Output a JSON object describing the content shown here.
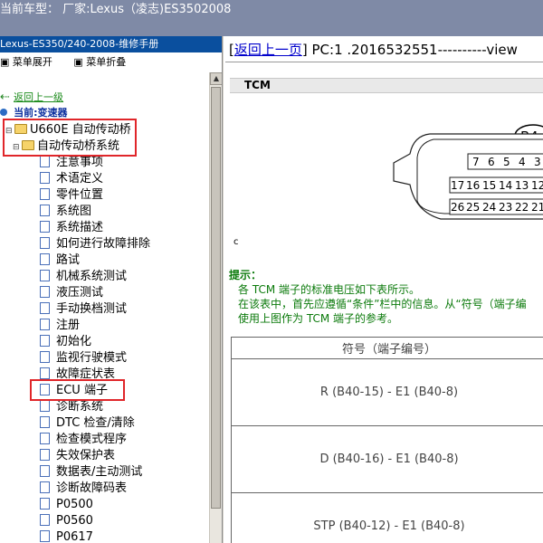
{
  "window": {
    "title": "当前车型：  厂家:Lexus（凌志)ES3502008"
  },
  "left_panel": {
    "header": "Lexus-ES350/240-2008-维修手册",
    "expand_all": "菜单展开",
    "collapse_all": "菜单折叠",
    "back_link": "返回上一级",
    "current_label": "当前:变速器",
    "folders": [
      {
        "label": "U660E 自动传动桥"
      },
      {
        "label": "自动传动桥系统"
      }
    ],
    "items": [
      "注意事项",
      "术语定义",
      "零件位置",
      "系统图",
      "系统描述",
      "如何进行故障排除",
      "路试",
      "机械系统测试",
      "液压测试",
      "手动换档测试",
      "注册",
      "初始化",
      "监视行驶模式",
      "故障症状表",
      "ECU 端子",
      "诊断系统",
      "DTC 检查/清除",
      "检查模式程序",
      "失效保护表",
      "数据表/主动测试",
      "诊断故障码表",
      "P0500",
      "P0560",
      "P0617"
    ],
    "selected_item": "ECU 端子"
  },
  "right_panel": {
    "back_link": "返回上一页",
    "header_text": " PC:1 .2016532551----------view",
    "section_title": "TCM",
    "connector_label": "B4",
    "connector_row1": [
      "7",
      "6",
      "5",
      "4",
      "3"
    ],
    "connector_row2": [
      "17",
      "16",
      "15",
      "14",
      "13",
      "12"
    ],
    "connector_row3": [
      "26",
      "25",
      "24",
      "23",
      "22",
      "21"
    ],
    "side_mark": "c",
    "hint_title": "提示：",
    "hint_lines": [
      "各 TCM 端子的标准电压如下表所示。",
      "在该表中，首先应遵循“条件”栏中的信息。从“符号（端子编",
      "使用上图作为 TCM 端子的参考。"
    ],
    "table_header": "符号（端子编号）",
    "table_rows": [
      "R (B40-15) - E1 (B40-8)",
      "D (B40-16) - E1 (B40-8)",
      "STP (B40-12) - E1 (B40-8)"
    ]
  }
}
